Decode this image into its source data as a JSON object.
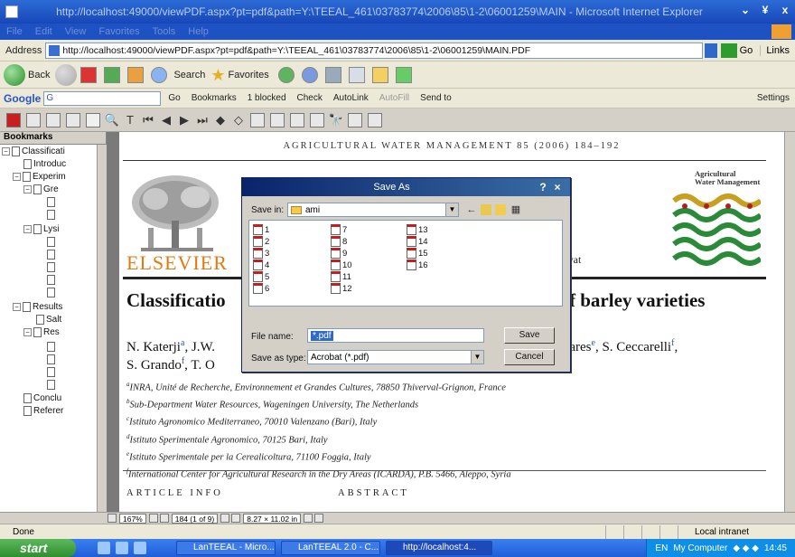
{
  "window": {
    "title": "http://localhost:49000/viewPDF.aspx?pt=pdf&path=Y:\\TEEAL_461\\03783774\\2006\\85\\1-2\\06001259\\MAIN - Microsoft Internet Explorer",
    "controls": [
      "⌄",
      "¥",
      "x"
    ]
  },
  "menu": {
    "items": [
      "File",
      "Edit",
      "View",
      "Favorites",
      "Tools",
      "Help"
    ]
  },
  "address": {
    "label": "Address",
    "url": "http://localhost:49000/viewPDF.aspx?pt=pdf&path=Y:\\TEEAL_461\\03783774\\2006\\85\\1-2\\06001259\\MAIN.PDF",
    "go_label": "Go",
    "links_label": "Links"
  },
  "toolbar": {
    "back_label": "Back",
    "search_label": "Search",
    "favorites_label": "Favorites"
  },
  "googlebar": {
    "logo": "Google",
    "input_prefix": "G",
    "go_label": "Go",
    "bookmarks_label": "Bookmarks",
    "blocked_label": "1 blocked",
    "check_label": "Check",
    "autolink_label": "AutoLink",
    "autofill_label": "AutoFill",
    "sendto_label": "Send to",
    "settings_label": "Settings"
  },
  "bookmarks": {
    "tab_label": "Bookmarks",
    "items": [
      "Classificati",
      "Introduc",
      "Experim",
      "Gre",
      "Lysi",
      "Results",
      "Salt",
      "Res",
      "Conclu",
      "Referer"
    ]
  },
  "document": {
    "journal_header": "AGRICULTURAL WATER MANAGEMENT 85 (2006) 184–192",
    "publisher": "ELSEVIER",
    "journal_logo_title": "Agricultural\nWater Management",
    "partial_text": "gwat",
    "title_left": "Classificatio",
    "title_right": "f barley varieties",
    "authors_l1_left": "N. Katerji",
    "authors_l1_left_sup": "a",
    "authors_l1_frag": ", J.W.",
    "authors_l1_right": "Fares",
    "authors_l1_right_sup": "e",
    "authors_l1_right2": ", S. Ceccarelli",
    "authors_l1_right2_sup": "f",
    "authors_l1_right2_end": ",",
    "authors_l2": "S. Grando",
    "authors_l2_sup": "f",
    "authors_l2_frag": ", T. O",
    "affiliations": [
      {
        "sup": "a",
        "text": "INRA, Unité de Recherche, Environnement et Grandes Cultures, 78850 Thiverval-Grignon, France"
      },
      {
        "sup": "b",
        "text": "Sub-Department Water Resources, Wageningen University, The Netherlands"
      },
      {
        "sup": "c",
        "text": "Istituto Agronomico Mediterraneo, 70010 Valenzano (Bari), Italy"
      },
      {
        "sup": "d",
        "text": "Istituto Sperimentale Agronomico, 70125 Bari, Italy"
      },
      {
        "sup": "e",
        "text": "Istituto Sperimentale per la Cerealicoltura, 71100 Foggia, Italy"
      },
      {
        "sup": "f",
        "text": "International Center for Agricultural Research in the Dry Areas (ICARDA), P.B. 5466, Aleppo, Syria"
      }
    ],
    "section_article_info": "ARTICLE INFO",
    "section_abstract": "ABSTRACT"
  },
  "reader_status": {
    "zoom": "167%",
    "page": "184 (1 of 9)",
    "page_size": "8.27 × 11.02 in"
  },
  "save_dialog": {
    "title": "Save As",
    "help": "?",
    "close": "×",
    "save_in_label": "Save in:",
    "save_in_value": "ami",
    "files": [
      "1",
      "2",
      "3",
      "4",
      "5",
      "6",
      "7",
      "8",
      "9",
      "10",
      "11",
      "12",
      "13",
      "14",
      "15",
      "16"
    ],
    "file_name_label": "File name:",
    "file_name_value": "*.pdf",
    "save_as_type_label": "Save as type:",
    "save_as_type_value": "Acrobat (*.pdf)",
    "save_button": "Save",
    "cancel_button": "Cancel"
  },
  "ie_status": {
    "text": "Done",
    "zone": "Local intranet"
  },
  "taskbar": {
    "start_label": "start",
    "tasks": [
      "LanTEEAL - Micro...",
      "LanTEEAL 2.0 - C...",
      "http://localhost:4..."
    ],
    "lang": "EN",
    "my_computer": "My Computer",
    "clock": "14:45"
  }
}
